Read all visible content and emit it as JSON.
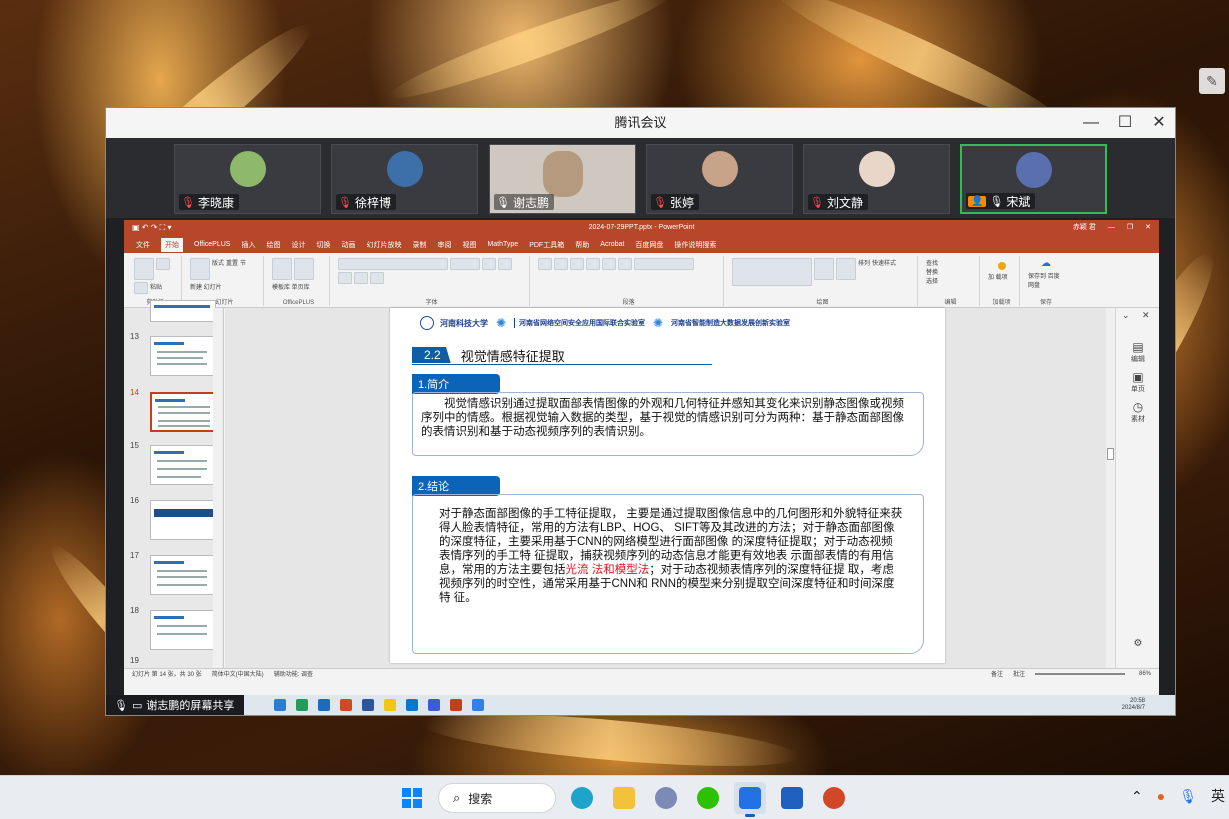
{
  "meeting": {
    "title": "腾讯会议",
    "controls": [
      "—",
      "☐",
      "✕"
    ],
    "participants": [
      {
        "name": "李晓康",
        "mic": "muted",
        "avatar_color": "#8fb96a"
      },
      {
        "name": "徐梓博",
        "mic": "muted",
        "avatar_color": "#3d6fa8"
      },
      {
        "name": "谢志鹏",
        "mic": "on",
        "avatar_color": "#b59a80"
      },
      {
        "name": "张婷",
        "mic": "muted",
        "avatar_color": "#c9a28a"
      },
      {
        "name": "刘文静",
        "mic": "muted",
        "avatar_color": "#e8d6c8"
      },
      {
        "name": "宋斌",
        "mic": "on",
        "avatar_color": "#5a6fb0",
        "host": true
      }
    ],
    "share_label": "谢志鹏的屏幕共享"
  },
  "ppt": {
    "title": "2024-07-29PPT.pptx - PowerPoint",
    "user": "赤颖 君",
    "menu": [
      "文件",
      "开始",
      "OfficePLUS",
      "插入",
      "绘图",
      "设计",
      "切换",
      "动画",
      "幻灯片放映",
      "录制",
      "审阅",
      "视图",
      "MathType",
      "PDF工具箱",
      "帮助",
      "Acrobat",
      "百度网盘",
      "操作说明搜索"
    ],
    "active_menu": "开始",
    "ribbon_groups": [
      "剪贴板",
      "幻灯片",
      "OfficePLUS",
      "字体",
      "段落",
      "绘图",
      "编辑",
      "加载项",
      "保存"
    ],
    "ribbon_texts": {
      "paste": "粘贴",
      "new_slide": "新建\n幻灯片",
      "layout": "版式",
      "reset": "重置",
      "section": "节",
      "template": "模板库 单页库",
      "arrange": "排列",
      "quick_style": "快速样式",
      "find": "查找",
      "replace": "替换",
      "select": "选择",
      "addin": "加\n载项",
      "save_baidu": "保存到\n百度网盘"
    },
    "thumbnails": [
      {
        "num": "13"
      },
      {
        "num": "14",
        "selected": true
      },
      {
        "num": "15"
      },
      {
        "num": "16",
        "dark": true
      },
      {
        "num": "17"
      },
      {
        "num": "18"
      },
      {
        "num": "19"
      }
    ],
    "right_pane": [
      {
        "label": "编辑",
        "glyph": "▤"
      },
      {
        "label": "单页",
        "glyph": "▣"
      },
      {
        "label": "素材",
        "glyph": "◷"
      }
    ],
    "status": {
      "slide_count": "幻灯片 第 14 张，共 30 张",
      "language": "简体中文(中国大陆)",
      "accessibility": "辅助功能: 调查",
      "notes": "备注",
      "comments": "批注",
      "zoom": "86%"
    }
  },
  "slide": {
    "logo1": "河南科技大学",
    "logo2": "河南省网络空间安全应用国际联合实验室",
    "logo3": "河南省智能制造大数据发展创新实验室",
    "section_num": "2.2",
    "section_title": "视觉情感特征提取",
    "intro_tag": "1.简介",
    "intro_text": "视觉情感识别通过提取面部表情图像的外观和几何特征并感知其变化来识别静态图像或视频序列中的情感。根据视觉输入数据的类型，基于视觉的情感识别可分为两种：基于静态面部图像的表情识别和基于动态视频序列的表情识别。",
    "conclusion_tag": "2.结论",
    "conclusion_text_a": "对于静态面部图像的手工特征提取， 主要是通过提取图像信息中的几何图形和外貌特征来获得人脸表情特征，常用的方法有LBP、HOG、 SIFT等及其改进的方法；对于静态面部图像的深度特征，主要采用基于CNN的网络模型进行面部图像 的深度特征提取；对于动态视频表情序列的手工特 征提取，捕获视频序列的动态信息才能更有效地表 示面部表情的有用信息，常用的方法主要包括",
    "conclusion_text_red": "光流 法和模型法",
    "conclusion_text_b": "；对于动态视频表情序列的深度特征提 取，考虑视频序列的时空性，通常采用基于CNN和 RNN的模型来分别提取空间深度特征和时间深度特 征。"
  },
  "inner_taskbar": {
    "time": "20:58",
    "date": "2024/8/7"
  },
  "taskbar": {
    "search_label": "搜索",
    "tray_lang": "英"
  }
}
